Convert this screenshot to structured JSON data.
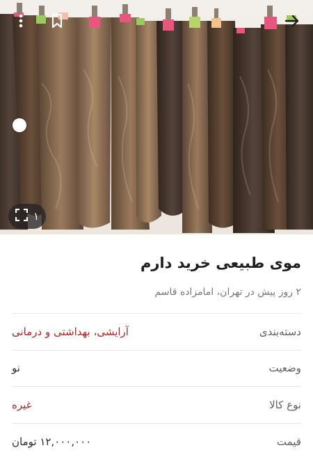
{
  "gallery": {
    "counter": "۱",
    "icons": {
      "back": "arrow-right-icon",
      "bookmark": "bookmark-icon",
      "more": "more-vertical-icon",
      "fullscreen": "fullscreen-icon"
    }
  },
  "listing": {
    "title": "موی طبیعی خرید دارم",
    "meta": "۲ روز پیش در تهران، امامزاده قاسم"
  },
  "details": [
    {
      "label": "دسته‌بندی",
      "value": "آرایشی، بهداشتی و درمانی",
      "link": true
    },
    {
      "label": "وضعیت",
      "value": "نو",
      "link": false
    },
    {
      "label": "نوع کالا",
      "value": "غیره",
      "link": true
    },
    {
      "label": "قیمت",
      "value": "۱۲,۰۰۰,۰۰۰ تومان",
      "link": false
    }
  ],
  "colors": {
    "link": "#a62626",
    "label": "#5f5f5f",
    "divider": "#e6e6e6"
  }
}
